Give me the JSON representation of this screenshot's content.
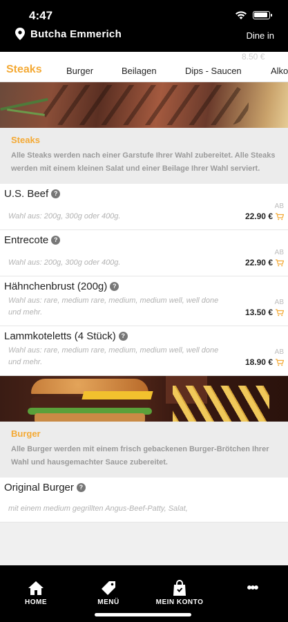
{
  "status": {
    "time": "4:47"
  },
  "header": {
    "restaurant": "Butcha Emmerich",
    "mode": "Dine in"
  },
  "tabs": {
    "peek_text": "8.50 €",
    "items": [
      "Steaks",
      "Burger",
      "Beilagen",
      "Dips - Saucen",
      "Alko"
    ]
  },
  "categories": [
    {
      "title": "Steaks",
      "description": "Alle Steaks werden nach einer Garstufe Ihrer Wahl zubereitet. Alle Steaks werden mit einem kleinen Salat und einer Beilage Ihrer Wahl serviert.",
      "items": [
        {
          "name": "U.S. Beef",
          "desc": "Wahl aus: 200g, 300g oder 400g.",
          "ab": "AB",
          "price": "22.90 €"
        },
        {
          "name": "Entrecote",
          "desc": "Wahl aus: 200g, 300g oder 400g.",
          "ab": "AB",
          "price": "22.90 €"
        },
        {
          "name": "Hähnchenbrust (200g)",
          "desc": "Wahl aus: rare, medium rare, medium, medium well, well done und mehr.",
          "ab": "AB",
          "price": "13.50 €"
        },
        {
          "name": "Lammkoteletts (4 Stück)",
          "desc": "Wahl aus: rare, medium rare, medium, medium well, well done und mehr.",
          "ab": "AB",
          "price": "18.90 €"
        }
      ]
    },
    {
      "title": "Burger",
      "description": "Alle Burger werden mit einem frisch gebackenen Burger-Brötchen Ihrer Wahl und hausgemachter Sauce zubereitet.",
      "items": [
        {
          "name": "Original Burger",
          "desc": "mit einem medium gegrillten Angus-Beef-Patty, Salat,",
          "ab": "",
          "price": ""
        }
      ]
    }
  ],
  "nav": [
    "HOME",
    "MENÜ",
    "MEIN KONTO",
    "•••"
  ],
  "colors": {
    "accent": "#f4a934",
    "header": "#000000"
  }
}
